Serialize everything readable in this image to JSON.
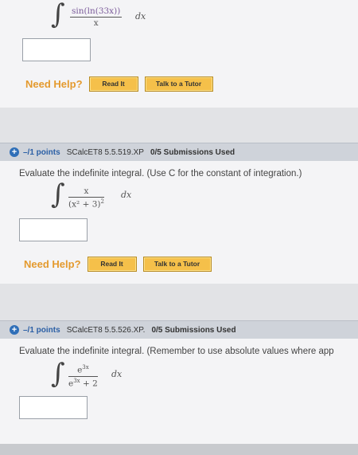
{
  "q0": {
    "integrand_num": "sin(ln(33x))",
    "integrand_den": "x",
    "dx": "dx",
    "answer": "",
    "need_help": "Need Help?",
    "read_it": "Read It",
    "talk_tutor": "Talk to a Tutor"
  },
  "q1": {
    "points": "–/1 points",
    "code": "SCalcET8 5.5.519.XP",
    "submissions": "0/5 Submissions Used",
    "prompt": "Evaluate the indefinite integral. (Use C for the constant of integration.)",
    "integrand_num": "x",
    "integrand_den_base": "(x² + 3)",
    "integrand_den_exp": "2",
    "dx": "dx",
    "answer": "",
    "need_help": "Need Help?",
    "read_it": "Read It",
    "talk_tutor": "Talk to a Tutor"
  },
  "q2": {
    "points": "–/1 points",
    "code": "SCalcET8 5.5.526.XP.",
    "submissions": "0/5 Submissions Used",
    "prompt": "Evaluate the indefinite integral. (Remember to use absolute values where app",
    "integrand_num_base": "e",
    "integrand_num_exp": "3x",
    "integrand_den_base": "e",
    "integrand_den_exp": "3x",
    "integrand_den_tail": " + 2",
    "dx": "dx",
    "answer": ""
  },
  "colors": {
    "accent_blue": "#2b5fa5",
    "help_orange": "#e49a2e",
    "button_yellow": "#f5c04a"
  }
}
